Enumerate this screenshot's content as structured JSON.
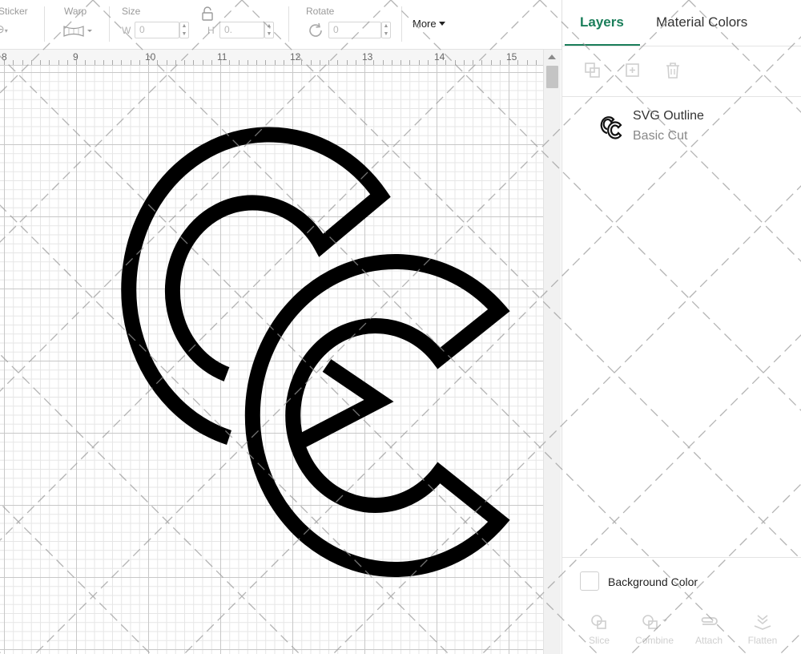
{
  "toolbar": {
    "sticker_label": "Sticker",
    "warp_label": "Warp",
    "size_label": "Size",
    "size_w_letter": "W",
    "size_w_value": "0",
    "size_h_letter": "H",
    "size_h_value": "0.",
    "rotate_label": "Rotate",
    "rotate_value": "0",
    "more_label": "More"
  },
  "ruler": {
    "marks": [
      "8",
      "9",
      "10",
      "11",
      "12",
      "13",
      "14",
      "15"
    ]
  },
  "panel": {
    "tabs": [
      {
        "label": "Layers",
        "active": true
      },
      {
        "label": "Material Colors",
        "active": false
      }
    ],
    "tools": [
      "group-icon",
      "duplicate-icon",
      "delete-icon"
    ],
    "layers": [
      {
        "name": "SVG Outline",
        "operation": "Basic Cut",
        "icon": "cc-logo-thumbnail"
      }
    ],
    "background_color_label": "Background Color",
    "bottom_actions": [
      {
        "label": "Slice",
        "icon": "slice-icon"
      },
      {
        "label": "Combine",
        "icon": "combine-icon"
      },
      {
        "label": "Attach",
        "icon": "attach-icon"
      },
      {
        "label": "Flatten",
        "icon": "flatten-icon"
      }
    ]
  },
  "colors": {
    "accent": "#1a7e5a",
    "design_stroke": "#000000"
  }
}
